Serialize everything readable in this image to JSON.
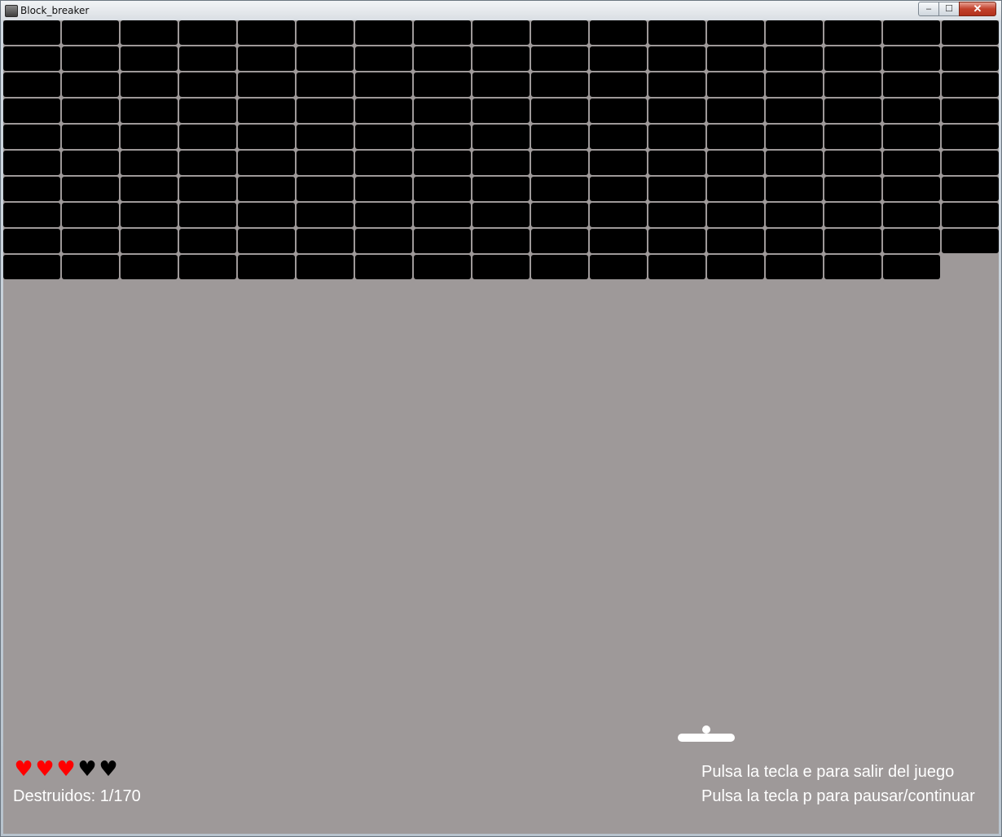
{
  "window": {
    "title": "Block_breaker",
    "minimize_glyph": "‒",
    "maximize_glyph": "☐",
    "close_glyph": "✕"
  },
  "game": {
    "background_color": "#9e9999",
    "brick_color": "#000000",
    "brick_columns": 17,
    "brick_rows": 10,
    "bricks_total": 170,
    "bricks_in_last_row": 16,
    "lives": {
      "total": 5,
      "remaining": 3,
      "full_color": "#ff0000",
      "lost_color": "#000000",
      "glyph": "♥"
    },
    "hud": {
      "destroyed": "Destruidos: 1/170",
      "exit_hint": "Pulsa la tecla e para salir del juego",
      "pause_hint": "Pulsa la tecla p para pausar/continuar"
    }
  }
}
